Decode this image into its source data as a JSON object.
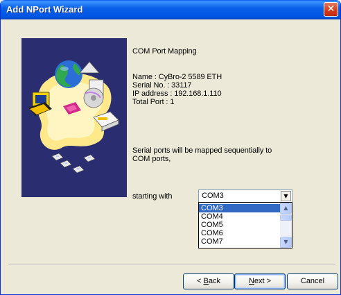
{
  "window": {
    "title": "Add NPort Wizard",
    "close_symbol": "✕"
  },
  "content": {
    "heading": "COM Port Mapping",
    "info": [
      "Name : CyBro-2 5589 ETH",
      "Serial No. : 33117",
      "IP address : 192.168.1.110",
      "Total Port : 1"
    ],
    "description_line1": "Serial ports will be mapped sequentially to",
    "description_line2": "COM ports,",
    "starting_label": "starting with"
  },
  "combo": {
    "selected": "COM3",
    "options": [
      "COM3",
      "COM4",
      "COM5",
      "COM6",
      "COM7"
    ],
    "highlighted_index": 0
  },
  "buttons": {
    "back_prefix": "< ",
    "back_hotkey": "B",
    "back_rest": "ack",
    "next_hotkey": "N",
    "next_rest": "ext >",
    "cancel": "Cancel"
  },
  "colors": {
    "titlebar": "#0054E3",
    "selection": "#316AC5",
    "dialog_bg": "#ECE9D8"
  }
}
